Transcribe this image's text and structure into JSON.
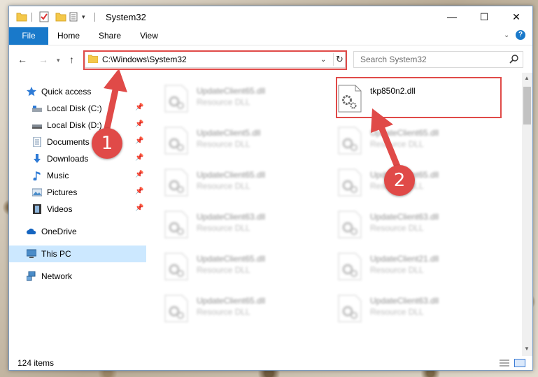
{
  "window": {
    "title": "System32",
    "controls": {
      "minimize": "—",
      "maximize": "☐",
      "close": "✕"
    }
  },
  "ribbon": {
    "tabs": [
      {
        "label": "File",
        "active": true
      },
      {
        "label": "Home"
      },
      {
        "label": "Share"
      },
      {
        "label": "View"
      }
    ]
  },
  "nav": {
    "address": "C:\\Windows\\System32",
    "search_placeholder": "Search System32"
  },
  "sidebar": {
    "items": [
      {
        "label": "Quick access",
        "icon": "star-icon",
        "pinned": false
      },
      {
        "label": "Local Disk (C:)",
        "icon": "drive-icon",
        "pinned": true
      },
      {
        "label": "Local Disk (D:)",
        "icon": "drive-icon",
        "pinned": true
      },
      {
        "label": "Documents",
        "icon": "documents-icon",
        "pinned": true
      },
      {
        "label": "Downloads",
        "icon": "download-icon",
        "pinned": true
      },
      {
        "label": "Music",
        "icon": "music-icon",
        "pinned": true
      },
      {
        "label": "Pictures",
        "icon": "pictures-icon",
        "pinned": true
      },
      {
        "label": "Videos",
        "icon": "videos-icon",
        "pinned": true
      },
      {
        "label": "OneDrive",
        "icon": "cloud-icon",
        "pinned": false
      },
      {
        "label": "This PC",
        "icon": "pc-icon",
        "pinned": false,
        "selected": true
      },
      {
        "label": "Network",
        "icon": "network-icon",
        "pinned": false
      }
    ]
  },
  "files": {
    "left_column": [
      {
        "name": "UpdateClient65.dll",
        "type": "Resource DLL"
      },
      {
        "name": "UpdateClient5.dll",
        "type": "Resource DLL"
      },
      {
        "name": "UpdateClient65.dll",
        "type": "Resource DLL"
      },
      {
        "name": "UpdateClient63.dll",
        "type": "Resource DLL"
      },
      {
        "name": "UpdateClient65.dll",
        "type": "Resource DLL"
      },
      {
        "name": "UpdateClient65.dll",
        "type": "Resource DLL"
      }
    ],
    "right_column": [
      {
        "name": "tkp850n2.dll",
        "type": ""
      },
      {
        "name": "UpdateClient65.dll",
        "type": "Resource DLL"
      },
      {
        "name": "UpdateClient65.dll",
        "type": "Resource DLL"
      },
      {
        "name": "UpdateClient63.dll",
        "type": "Resource DLL"
      },
      {
        "name": "UpdateClient21.dll",
        "type": "Resource DLL"
      },
      {
        "name": "UpdateClient63.dll",
        "type": "Resource DLL"
      }
    ]
  },
  "status": {
    "item_count": "124 items"
  },
  "annotations": {
    "step1": "1",
    "step2": "2",
    "color": "#e04a48"
  }
}
